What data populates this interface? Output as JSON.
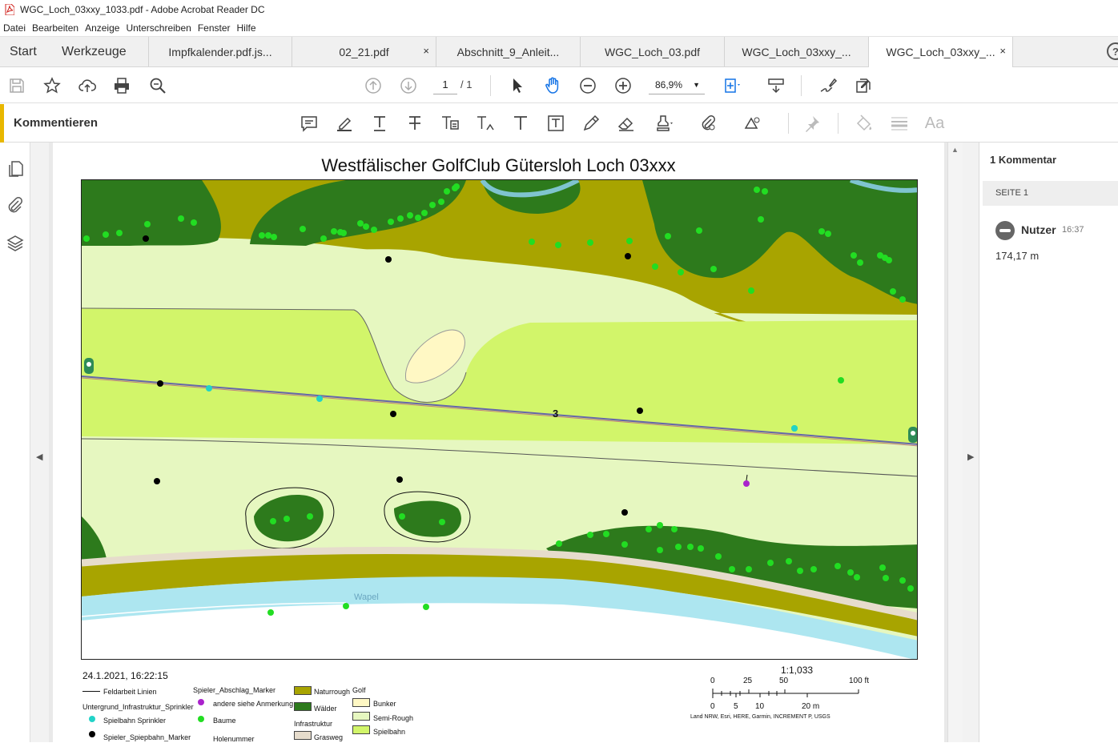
{
  "window": {
    "title": "WGC_Loch_03xxy_1033.pdf - Adobe Acrobat Reader DC"
  },
  "menu": [
    "Datei",
    "Bearbeiten",
    "Anzeige",
    "Unterschreiben",
    "Fenster",
    "Hilfe"
  ],
  "nav": {
    "start": "Start",
    "tools": "Werkzeuge",
    "help": "?"
  },
  "tabs": [
    {
      "label": "Impfkalender.pdf.js...",
      "closable": false
    },
    {
      "label": "02_21.pdf",
      "closable": true
    },
    {
      "label": "Abschnitt_9_Anleit...",
      "closable": false
    },
    {
      "label": "WGC_Loch_03.pdf",
      "closable": false
    },
    {
      "label": "WGC_Loch_03xxy_...",
      "closable": false
    },
    {
      "label": "WGC_Loch_03xxy_...",
      "closable": true,
      "active": true
    }
  ],
  "tab_close_glyph": "×",
  "toolbar": {
    "page_current": "1",
    "page_total": "/ 1",
    "zoom": "86,9%"
  },
  "comment_bar": {
    "label": "Kommentieren",
    "font_tool": "Aa"
  },
  "comments_panel": {
    "count_label": "1 Kommentar",
    "page_header": "SEITE 1",
    "author": "Nutzer",
    "time": "16:37",
    "text": "174,17 m"
  },
  "map": {
    "title": "Westfälischer GolfClub Gütersloh Loch 03xxx",
    "hole_label": "3",
    "river_label": "Wapel",
    "date": "24.1.2021, 16:22:15",
    "colors": {
      "naturrough": "#a8a400",
      "waelder": "#2d7a1c",
      "semi_rough": "#e6f7c0",
      "spielbahn": "#d2f56a",
      "bunker": "#fff8c4",
      "grasweg": "#e6dccc",
      "water": "#ade6f0",
      "sprinkler": "#22d3c8",
      "baeume": "#22dd22",
      "marker": "#000000",
      "anmerkung": "#aa22cc",
      "line": "#6666aa"
    }
  },
  "legend": {
    "feldarbeit": "Feldarbeit Linien",
    "untergrund": "Untergrund_Infrastruktur_Sprinkler",
    "spielbahn_sprinkler": "Spielbahn Sprinkler",
    "spieler_marker": "Spieler_Spiepbahn_Marker",
    "abschlag": "Spieler_Abschlag_Marker",
    "anmerkung": "andere siehe Anmerkung",
    "baeume": "Baume",
    "holenummer": "Holenummer",
    "naturrough": "Naturrough",
    "waelder": "Wälder",
    "infrastruktur": "Infrastruktur",
    "grasweg": "Grasweg",
    "golf": "Golf",
    "bunker": "Bunker",
    "semi_rough": "Semi-Rough",
    "spielbahn": "Spielbahn"
  },
  "scale": {
    "ratio": "1:1,033",
    "ft_ticks": [
      "0",
      "25",
      "50",
      "100 ft"
    ],
    "m_ticks": [
      "0",
      "5",
      "10",
      "20 m"
    ],
    "credit": "Land NRW, Esri, HERE, Garmin, INCREMENT P, USGS"
  }
}
